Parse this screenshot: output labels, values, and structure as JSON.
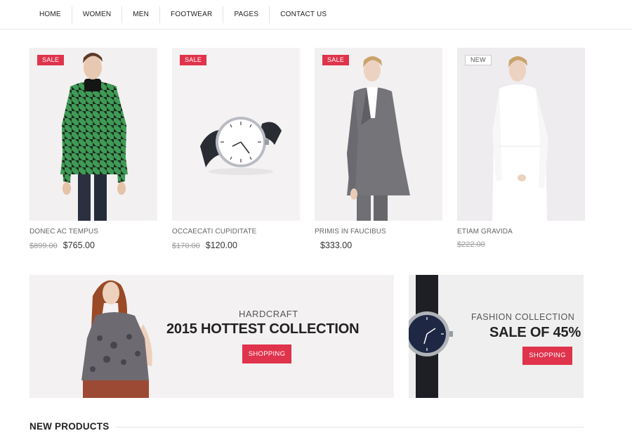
{
  "nav": {
    "items": [
      {
        "label": "HOME"
      },
      {
        "label": "WOMEN"
      },
      {
        "label": "MEN"
      },
      {
        "label": "FOOTWEAR"
      },
      {
        "label": "PAGES"
      },
      {
        "label": "CONTACT US"
      }
    ]
  },
  "products": [
    {
      "badge": "SALE",
      "name": "DONEC AC TEMPUS",
      "old_price": "$899.00",
      "price": "$765.00",
      "image": "man-green-scarf-photo"
    },
    {
      "badge": "SALE",
      "name": "OCCAECATI CUPIDITATE",
      "old_price": "$170.00",
      "price": "$120.00",
      "image": "wristwatch-photo"
    },
    {
      "badge": "SALE",
      "name": "PRIMIS IN FAUCIBUS",
      "old_price": "",
      "price": "$333.00",
      "image": "woman-grey-suit-photo"
    },
    {
      "badge": "NEW",
      "name": "ETIAM GRAVIDA",
      "old_price": "$222.00",
      "price": "",
      "image": "woman-white-outfit-photo"
    }
  ],
  "banners": {
    "left": {
      "subtitle": "HARDCRAFT",
      "title": "2015 HOTTEST COLLECTION",
      "button": "SHOPPING",
      "image": "woman-paisley-top-photo"
    },
    "right": {
      "subtitle": "FASHION COLLECTION",
      "title": "SALE OF 45%",
      "button": "SHOPPING",
      "image": "navy-watch-photo"
    }
  },
  "section": {
    "title": "NEW PRODUCTS"
  },
  "colors": {
    "accent": "#e0334c",
    "panel": "#f2f0f1"
  }
}
